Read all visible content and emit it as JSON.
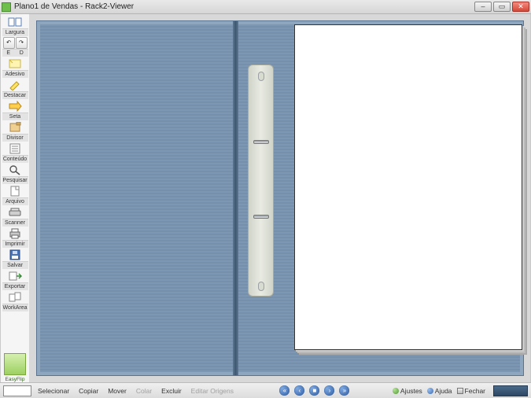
{
  "window": {
    "title": "Plano1 de Vendas - Rack2-Viewer"
  },
  "sidebar": {
    "largura": "Largura",
    "e": "E",
    "d": "D",
    "adesivo": "Adesivo",
    "destacar": "Destacar",
    "seta": "Seta",
    "divisor": "Divisor",
    "conteudo": "Conteúdo",
    "pesquisar": "Pesquisar",
    "arquivo": "Arquivo",
    "scanner": "Scanner",
    "imprimir": "Imprimir",
    "salvar": "Salvar",
    "exportar": "Exportar",
    "workarea": "WorkArea",
    "easyflip": "EasyFlip"
  },
  "bottom": {
    "selecionar": "Selecionar",
    "copiar": "Copiar",
    "mover": "Mover",
    "colar": "Colar",
    "excluir": "Excluir",
    "editar_origens": "Editar Origens",
    "ajustes": "Ajustes",
    "ajuda": "Ajuda",
    "fechar": "Fechar"
  }
}
